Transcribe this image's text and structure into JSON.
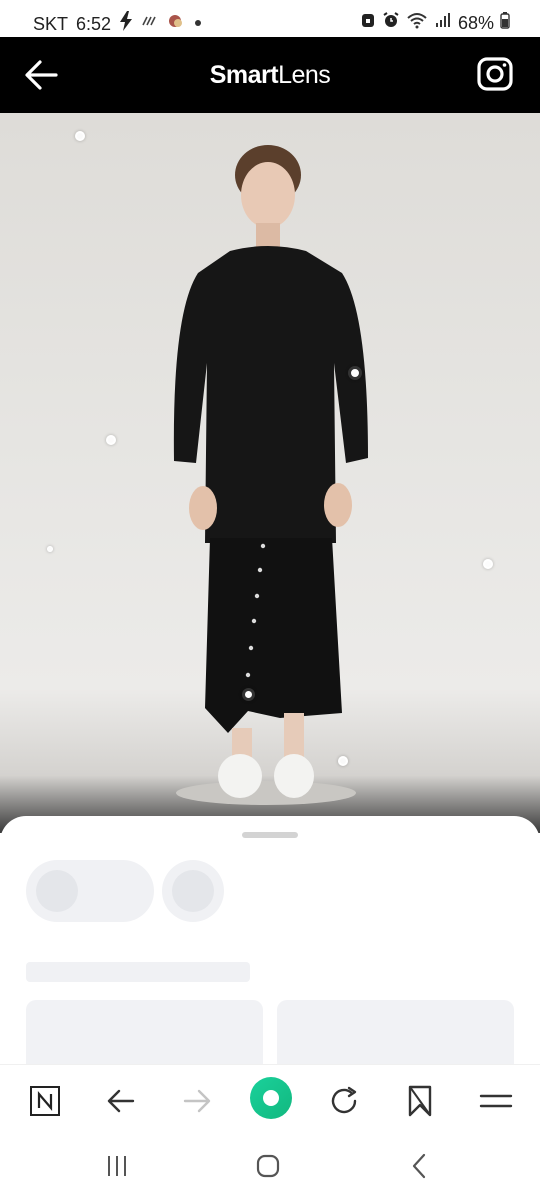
{
  "status_bar": {
    "carrier": "SKT",
    "time": "6:52",
    "battery": "68%",
    "left_icons": [
      "bolt-icon",
      "signal-waves-icon",
      "app-notification-icon",
      "dot-icon"
    ],
    "right_icons": [
      "alarm-lock-icon",
      "alarm-clock-icon",
      "wifi-icon",
      "cell-signal-icon",
      "battery-icon"
    ]
  },
  "header": {
    "title_bold": "Smart",
    "title_light": "Lens",
    "back_icon": "arrow-left-icon",
    "camera_icon": "camera-icon",
    "background": "#000000"
  },
  "photo": {
    "hotspot_count": 9,
    "active_hotspot": "sleeve"
  },
  "sheet": {
    "state": "loading"
  },
  "toolbar": {
    "buttons": [
      "naver-home-icon",
      "back-arrow-icon",
      "forward-arrow-icon",
      "smart-lens-icon",
      "reload-icon",
      "bookmark-icon",
      "menu-icon"
    ],
    "accent": "#1ad19b"
  },
  "system_nav": {
    "buttons": [
      "recent-apps-icon",
      "home-icon",
      "back-icon"
    ]
  }
}
